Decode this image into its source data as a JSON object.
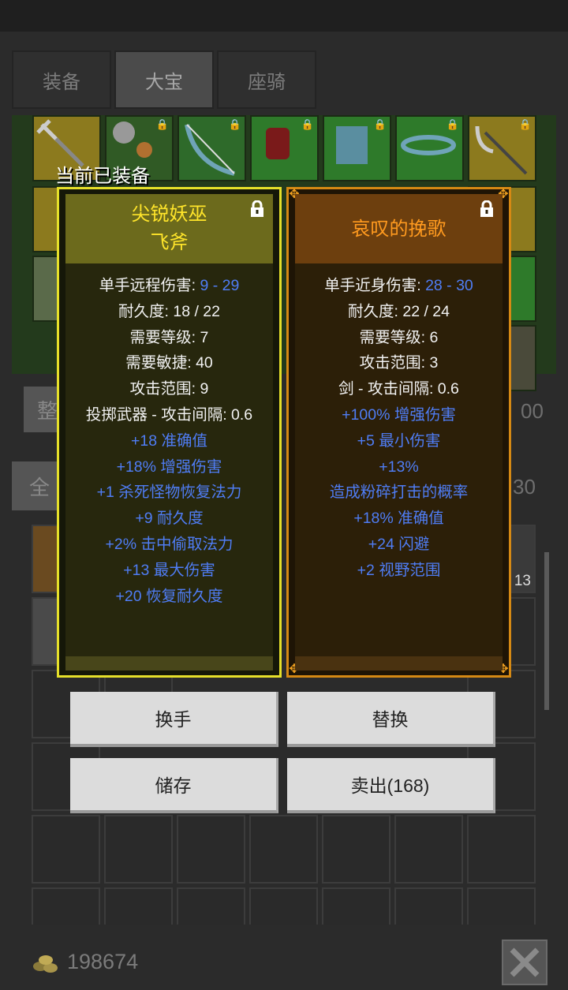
{
  "tabs": [
    {
      "label": "装备",
      "active": false
    },
    {
      "label": "大宝",
      "active": true
    },
    {
      "label": "座骑",
      "active": false
    }
  ],
  "background": {
    "sort_button_fragment": "整",
    "filter_button_fragment": "全",
    "count_fragment_1": "00",
    "count_fragment_2": "30",
    "stack_count": "13"
  },
  "equipped_label": "当前已装备",
  "left_card": {
    "title_line1": "尖锐妖巫",
    "title_line2": "飞斧",
    "locked": true,
    "stats": [
      {
        "label": "单手远程伤害: ",
        "value": "9 - 29",
        "style": "w"
      },
      {
        "label": "耐久度: 18 / 22",
        "style": "w"
      },
      {
        "label": "需要等级: 7",
        "style": "w"
      },
      {
        "label": "需要敏捷: 40",
        "style": "w"
      },
      {
        "label": "攻击范围: 9",
        "style": "w"
      },
      {
        "label": "投掷武器 - 攻击间隔: 0.6",
        "style": "w"
      },
      {
        "label": "+18 准确值",
        "style": "b"
      },
      {
        "label": "+18% 增强伤害",
        "style": "b"
      },
      {
        "label": "+1 杀死怪物恢复法力",
        "style": "b"
      },
      {
        "label": "+9 耐久度",
        "style": "b"
      },
      {
        "label": "+2% 击中偷取法力",
        "style": "b"
      },
      {
        "label": "+13 最大伤害",
        "style": "b"
      },
      {
        "label": "+20 恢复耐久度",
        "style": "b"
      }
    ]
  },
  "right_card": {
    "title": "哀叹的挽歌",
    "locked": true,
    "stats": [
      {
        "label": "单手近身伤害: ",
        "value": "28 - 30",
        "style": "w"
      },
      {
        "label": "耐久度: 22 / 24",
        "style": "w"
      },
      {
        "label": "需要等级: 6",
        "style": "w"
      },
      {
        "label": "攻击范围: 3",
        "style": "w"
      },
      {
        "label": "剑 - 攻击间隔: 0.6",
        "style": "w"
      },
      {
        "label": "+100% 增强伤害",
        "style": "b"
      },
      {
        "label": "+5 最小伤害",
        "style": "b"
      },
      {
        "label": "+13%",
        "style": "b"
      },
      {
        "label": "造成粉碎打击的概率",
        "style": "b"
      },
      {
        "label": "+18% 准确值",
        "style": "b"
      },
      {
        "label": "+24 闪避",
        "style": "b"
      },
      {
        "label": "+2 视野范围",
        "style": "b"
      }
    ]
  },
  "actions": {
    "swap_hand": "换手",
    "replace": "替换",
    "store": "储存",
    "sell": "卖出(168)"
  },
  "footer": {
    "gold_amount": "198674",
    "gold_icon": "gold-coins-icon",
    "close_icon": "close-x-icon"
  },
  "colors": {
    "left_border": "#e6e02a",
    "right_border": "#d58914",
    "stat_blue": "#4f7df5",
    "left_title": "#ffe52a",
    "right_title": "#ff9a1f"
  }
}
